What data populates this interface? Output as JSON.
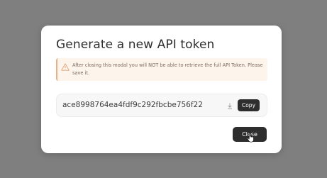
{
  "modal": {
    "title": "Generate a new API token",
    "warning": {
      "icon": "warning-triangle-icon",
      "text": "After closing this modal you will NOT be able to retrieve the full API Token. Please save it."
    },
    "token": {
      "value": "ace8998764ea4fdf9c292fbcbe756f22",
      "download_icon": "download-icon",
      "copy_label": "Copy"
    },
    "close_label": "Close"
  },
  "colors": {
    "overlay": "#7f7f7f",
    "modal_background": "#ffffff",
    "warning_background": "#fdf4ec",
    "warning_accent": "#e7b184",
    "button_background": "#2e2e2e",
    "button_text": "#ffffff"
  },
  "cursor": "hand-pointer-icon"
}
